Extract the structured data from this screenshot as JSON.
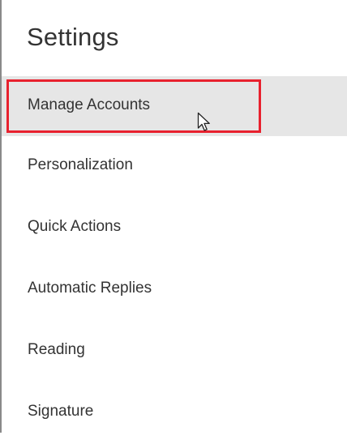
{
  "settings": {
    "title": "Settings",
    "items": [
      {
        "label": "Manage Accounts",
        "selected": true
      },
      {
        "label": "Personalization",
        "selected": false
      },
      {
        "label": "Quick Actions",
        "selected": false
      },
      {
        "label": "Automatic Replies",
        "selected": false
      },
      {
        "label": "Reading",
        "selected": false
      },
      {
        "label": "Signature",
        "selected": false
      }
    ]
  },
  "colors": {
    "highlight": "#e8212e",
    "selected_background": "#e6e6e6",
    "text": "#333333"
  },
  "icons": {
    "cursor": "mouse-pointer-icon"
  }
}
